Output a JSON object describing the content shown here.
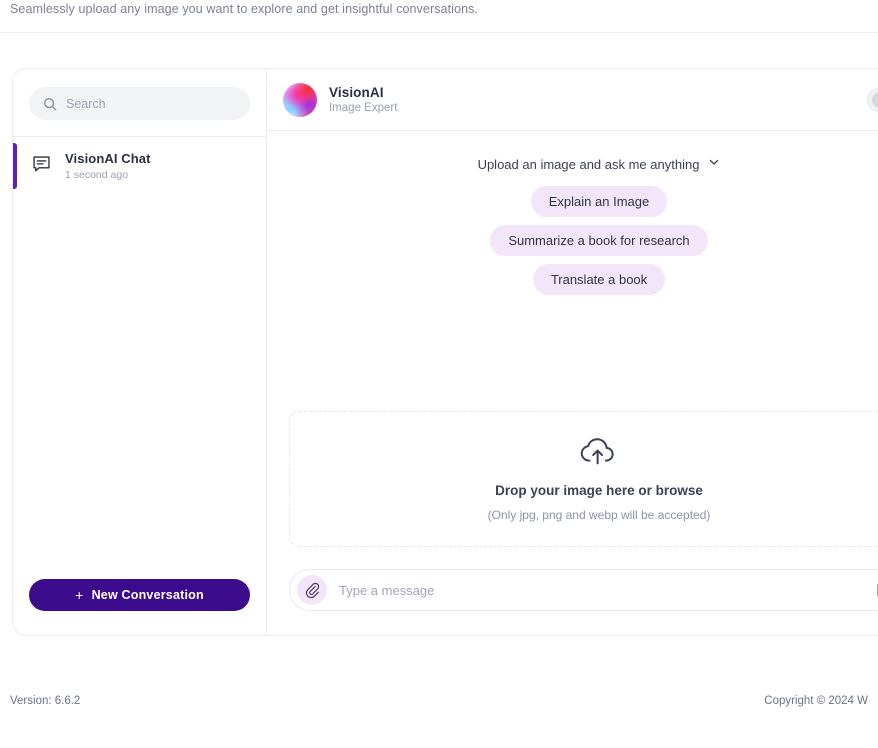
{
  "tagline": "Seamlessly upload any image you want to explore and get insightful conversations.",
  "sidebar": {
    "search": {
      "placeholder": "Search",
      "value": "",
      "icon": "search-icon"
    },
    "chats": [
      {
        "icon": "chat-bubble-icon",
        "title": "VisionAI Chat",
        "time": "1 second ago",
        "active": true
      }
    ],
    "new_conversation": {
      "label": "New Conversation",
      "plus": "+"
    }
  },
  "main": {
    "header": {
      "avatar_icon": "gradient-sphere-avatar",
      "agent_name": "VisionAI",
      "agent_role": "Image Expert",
      "toggle": {
        "state": "off",
        "icon": "toggle-switch-icon"
      }
    },
    "prompts": {
      "heading": "Upload an image and ask me anything",
      "chevron_icon": "chevron-down-icon",
      "suggestions": [
        "Explain an Image",
        "Summarize a book for research",
        "Translate a book"
      ]
    },
    "dropzone": {
      "icon": "cloud-upload-icon",
      "title": "Drop your image here or browse",
      "subtitle": "(Only jpg, png and webp will be accepted)"
    },
    "composer": {
      "attach_icon": "paperclip-icon",
      "placeholder": "Type a message",
      "value": "",
      "send_icon": "send-list-icon"
    }
  },
  "footer": {
    "version": "Version: 6.6.2",
    "copyright": "Copyright © 2024 W"
  },
  "colors": {
    "accent_purple": "#3b0b8c",
    "active_bar": "#5b21b6",
    "pill_bg": "#f3e6fb",
    "text_primary": "#2b3040",
    "text_muted": "#9aa0b0",
    "border": "#ececf0"
  }
}
